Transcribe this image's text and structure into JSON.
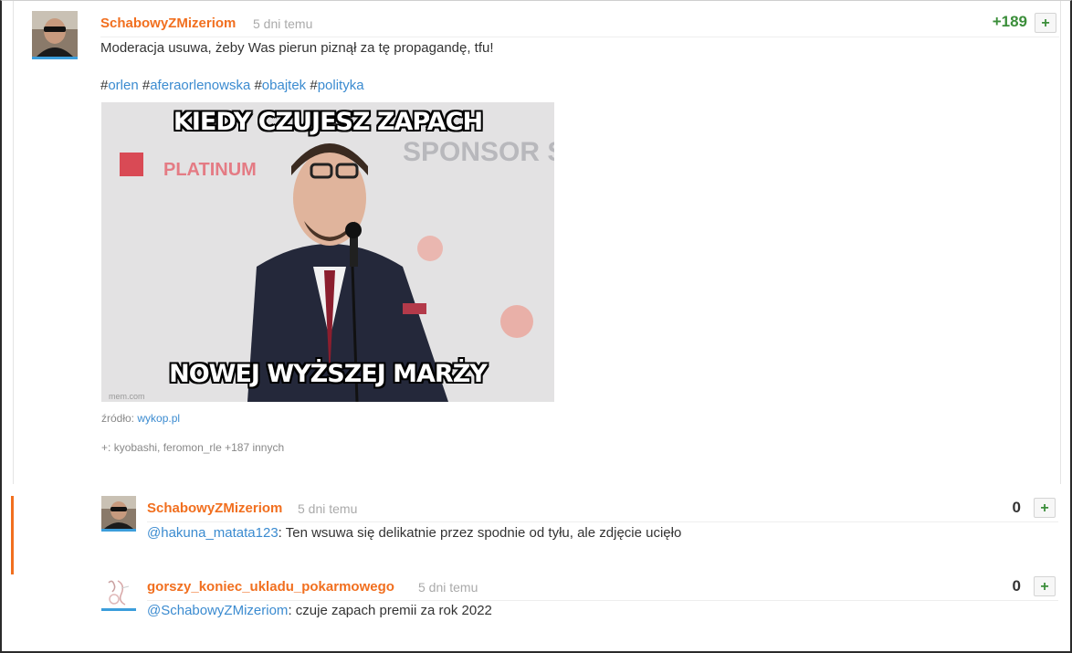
{
  "post": {
    "author": "SchabowyZMizeriom",
    "time": "5 dni temu",
    "score": "+189",
    "plus": "+",
    "text": "Moderacja usuwa, żeby Was pierun piznął za tę propagandę, tfu!",
    "tags": [
      {
        "hash": "#",
        "name": "orlen"
      },
      {
        "hash": "#",
        "name": "aferaorlenowska"
      },
      {
        "hash": "#",
        "name": "obajtek"
      },
      {
        "hash": "#",
        "name": "polityka"
      }
    ],
    "meme": {
      "top_caption": "KIEDY CZUJESZ ZAPACH",
      "bottom_caption": "NOWEJ WYŻSZEJ MARŻY",
      "bg_text_left": "PLATINUM",
      "bg_text_right": "SPONSOR STRAT"
    },
    "source_label": "źródło:",
    "source_link": "wykop.pl",
    "voters_prefix": "+:",
    "voters": "kyobashi, feromon_rle +187 innych"
  },
  "comments": [
    {
      "author": "SchabowyZMizeriom",
      "time": "5 dni temu",
      "score": "0",
      "plus": "+",
      "mention": "@hakuna_matata123",
      "text": ": Ten wsuwa się delikatnie przez spodnie od tyłu, ale zdjęcie ucięło"
    },
    {
      "author": "gorszy_koniec_ukladu_pokarmowego",
      "time": "5 dni temu",
      "score": "0",
      "plus": "+",
      "mention": "@SchabowyZMizeriom",
      "text": ": czuje zapach premii za rok 2022"
    }
  ],
  "colors": {
    "username": "#f16f1f",
    "link": "#3b8bd0",
    "score_positive": "#3b8e3a",
    "avatar_underline": "#3c9edb"
  }
}
